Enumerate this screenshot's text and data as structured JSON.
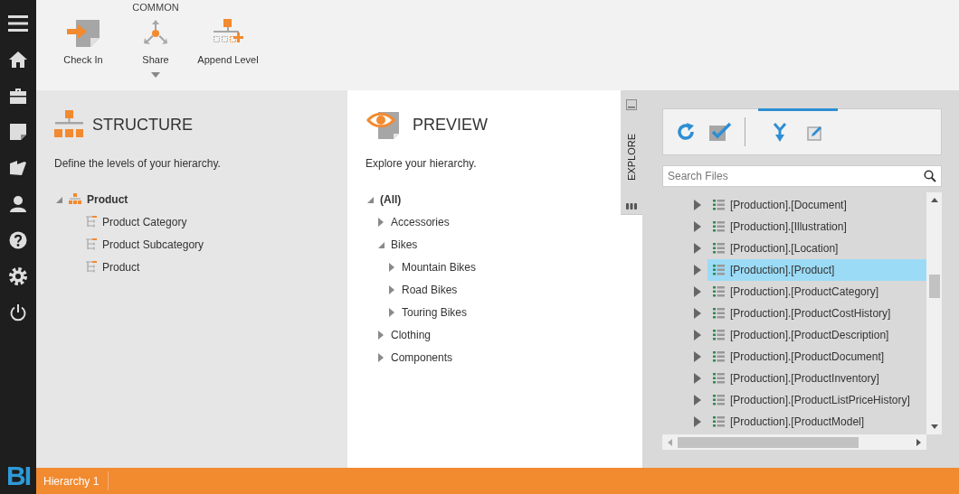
{
  "toolbar": {
    "group_label": "COMMON",
    "buttons": [
      {
        "kind": "check-in",
        "label": "Check In",
        "has_dropdown": false
      },
      {
        "kind": "share",
        "label": "Share",
        "has_dropdown": true
      },
      {
        "kind": "append-level",
        "label": "Append Level",
        "has_dropdown": false
      }
    ]
  },
  "sidebar": {
    "items": [
      {
        "kind": "home"
      },
      {
        "kind": "briefcase"
      },
      {
        "kind": "note"
      },
      {
        "kind": "folder"
      },
      {
        "kind": "user"
      },
      {
        "kind": "help"
      },
      {
        "kind": "settings"
      },
      {
        "kind": "power"
      }
    ],
    "logo": "BI"
  },
  "structure": {
    "title": "STRUCTURE",
    "description": "Define the levels of your hierarchy.",
    "tree": [
      {
        "label": "Product",
        "expanded": true,
        "children": [
          {
            "label": "Product Category"
          },
          {
            "label": "Product Subcategory"
          },
          {
            "label": "Product"
          }
        ]
      }
    ]
  },
  "preview": {
    "title": "PREVIEW",
    "description": "Explore your hierarchy.",
    "tree": [
      {
        "label": "(All)",
        "expanded": true,
        "children": [
          {
            "label": "Accessories",
            "expanded": false
          },
          {
            "label": "Bikes",
            "expanded": true,
            "children": [
              {
                "label": "Mountain Bikes",
                "expanded": false
              },
              {
                "label": "Road Bikes",
                "expanded": false
              },
              {
                "label": "Touring Bikes",
                "expanded": false
              }
            ]
          },
          {
            "label": "Clothing",
            "expanded": false
          },
          {
            "label": "Components",
            "expanded": false
          }
        ]
      }
    ]
  },
  "explore": {
    "tab_label": "EXPLORE",
    "search": {
      "placeholder": "Search Files"
    },
    "rows": [
      {
        "label": "[Production].[Document]",
        "expanded": false,
        "selected": false
      },
      {
        "label": "[Production].[Illustration]",
        "expanded": false,
        "selected": false
      },
      {
        "label": "[Production].[Location]",
        "expanded": false,
        "selected": false
      },
      {
        "label": "[Production].[Product]",
        "expanded": false,
        "selected": true
      },
      {
        "label": "[Production].[ProductCategory]",
        "expanded": false,
        "selected": false
      },
      {
        "label": "[Production].[ProductCostHistory]",
        "expanded": false,
        "selected": false
      },
      {
        "label": "[Production].[ProductDescription]",
        "expanded": false,
        "selected": false
      },
      {
        "label": "[Production].[ProductDocument]",
        "expanded": false,
        "selected": false
      },
      {
        "label": "[Production].[ProductInventory]",
        "expanded": false,
        "selected": false
      },
      {
        "label": "[Production].[ProductListPriceHistory]",
        "expanded": false,
        "selected": false
      },
      {
        "label": "[Production].[ProductModel]",
        "expanded": false,
        "selected": false
      }
    ]
  },
  "status_bar": {
    "tabs": [
      {
        "label": "Hierarchy 1",
        "selected": true
      }
    ]
  }
}
